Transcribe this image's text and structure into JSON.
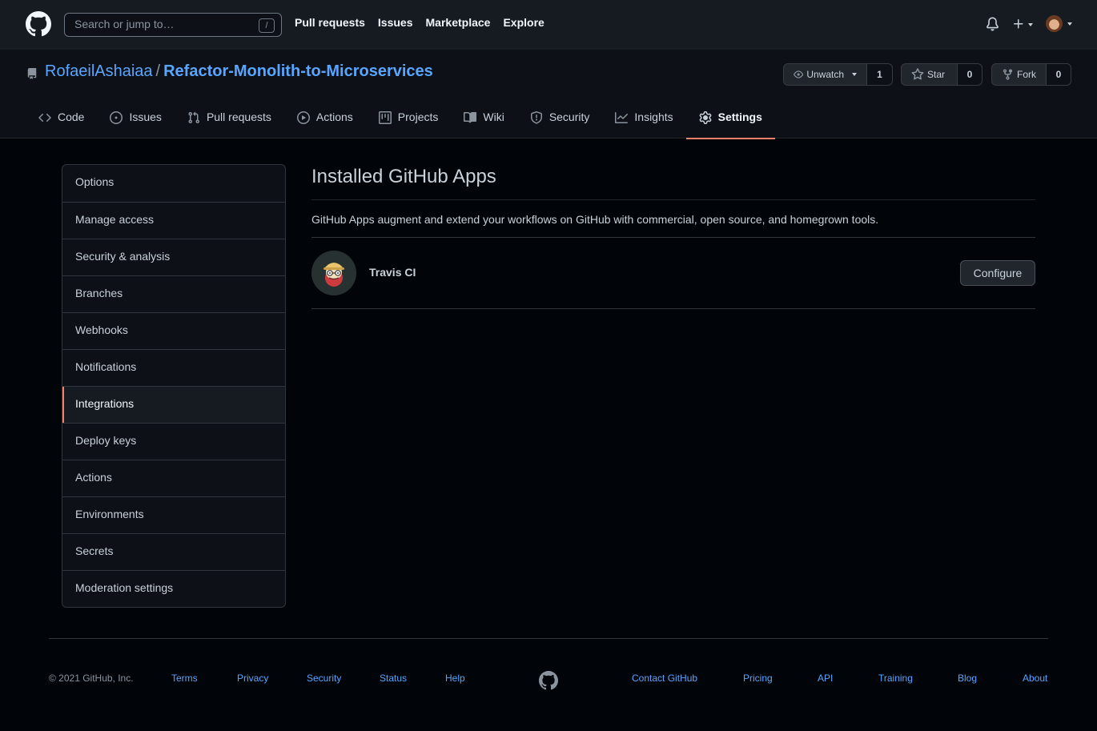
{
  "header": {
    "search_placeholder": "Search or jump to…",
    "search_shortcut": "/",
    "nav": [
      "Pull requests",
      "Issues",
      "Marketplace",
      "Explore"
    ]
  },
  "repo": {
    "owner": "RofaeilAshaiaa",
    "separator": "/",
    "name": "Refactor-Monolith-to-Microservices",
    "watch_label": "Unwatch",
    "watch_count": "1",
    "star_label": "Star",
    "star_count": "0",
    "fork_label": "Fork",
    "fork_count": "0"
  },
  "tabs": [
    {
      "label": "Code",
      "icon": "code-icon"
    },
    {
      "label": "Issues",
      "icon": "issue-icon"
    },
    {
      "label": "Pull requests",
      "icon": "pull-request-icon"
    },
    {
      "label": "Actions",
      "icon": "play-icon"
    },
    {
      "label": "Projects",
      "icon": "project-icon"
    },
    {
      "label": "Wiki",
      "icon": "book-icon"
    },
    {
      "label": "Security",
      "icon": "shield-icon"
    },
    {
      "label": "Insights",
      "icon": "graph-icon"
    },
    {
      "label": "Settings",
      "icon": "gear-icon",
      "active": true
    }
  ],
  "sidebar": {
    "items": [
      {
        "label": "Options"
      },
      {
        "label": "Manage access"
      },
      {
        "label": "Security & analysis"
      },
      {
        "label": "Branches"
      },
      {
        "label": "Webhooks"
      },
      {
        "label": "Notifications"
      },
      {
        "label": "Integrations",
        "selected": true
      },
      {
        "label": "Deploy keys"
      },
      {
        "label": "Actions"
      },
      {
        "label": "Environments"
      },
      {
        "label": "Secrets"
      },
      {
        "label": "Moderation settings"
      }
    ]
  },
  "main": {
    "title": "Installed GitHub Apps",
    "description": "GitHub Apps augment and extend your workflows on GitHub with commercial, open source, and homegrown tools.",
    "apps": [
      {
        "name": "Travis CI",
        "action": "Configure"
      }
    ]
  },
  "footer": {
    "copyright": "© 2021 GitHub, Inc.",
    "left_links": [
      "Terms",
      "Privacy",
      "Security",
      "Status",
      "Help"
    ],
    "right_links": [
      "Contact GitHub",
      "Pricing",
      "API",
      "Training",
      "Blog",
      "About"
    ]
  },
  "colors": {
    "accent": "#f78166",
    "link": "#58a6ff",
    "background": "#010409"
  }
}
